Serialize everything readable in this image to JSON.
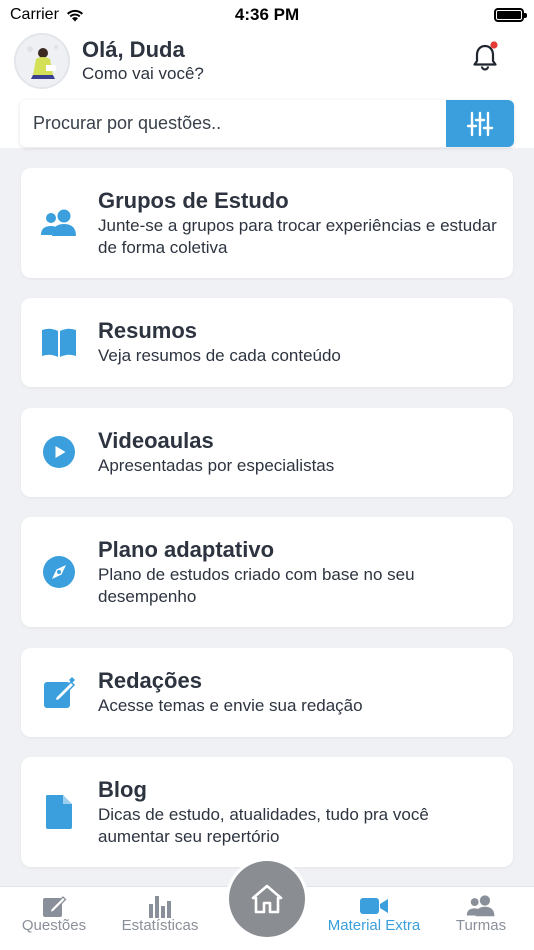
{
  "status_bar": {
    "carrier": "Carrier",
    "time": "4:36 PM"
  },
  "header": {
    "greeting": "Olá, Duda",
    "subgreeting": "Como vai você?",
    "notification_dot_color": "#e53935"
  },
  "search": {
    "placeholder": "Procurar por questões.."
  },
  "colors": {
    "accent": "#3a9fdc",
    "text": "#2d3440",
    "background": "#f0f1f5",
    "tab_inactive": "#8a9099",
    "home_button": "#8a8d92"
  },
  "cards": [
    {
      "icon": "users-icon",
      "title": "Grupos de Estudo",
      "description": "Junte-se a grupos para trocar experiências e estudar de forma coletiva"
    },
    {
      "icon": "book-icon",
      "title": "Resumos",
      "description": "Veja resumos de cada conteúdo"
    },
    {
      "icon": "play-icon",
      "title": "Videoaulas",
      "description": "Apresentadas por especialistas"
    },
    {
      "icon": "compass-icon",
      "title": "Plano adaptativo",
      "description": "Plano de estudos criado com base no seu desempenho"
    },
    {
      "icon": "edit-icon",
      "title": "Redações",
      "description": "Acesse temas e envie sua redação"
    },
    {
      "icon": "document-icon",
      "title": "Blog",
      "description": "Dicas de estudo, atualidades, tudo pra você aumentar seu repertório"
    }
  ],
  "tabbar": {
    "items": [
      {
        "icon": "pencil-square-icon",
        "label": "Questões",
        "active": false
      },
      {
        "icon": "bar-chart-icon",
        "label": "Estatísticas",
        "active": false
      },
      {
        "icon": "home-icon",
        "label": "",
        "active": false
      },
      {
        "icon": "video-camera-icon",
        "label": "Material Extra",
        "active": true
      },
      {
        "icon": "users-icon",
        "label": "Turmas",
        "active": false
      }
    ]
  }
}
